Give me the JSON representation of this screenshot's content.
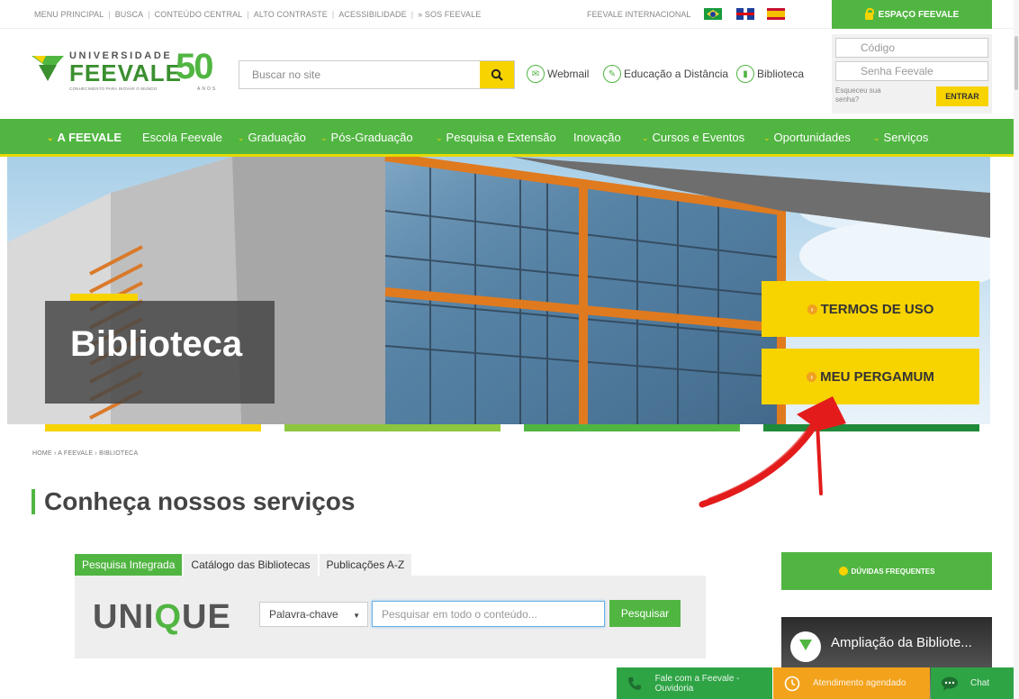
{
  "util": {
    "links": [
      "MENU PRINCIPAL",
      "BUSCA",
      "CONTEÚDO CENTRAL",
      "ALTO CONTRASTE",
      "ACESSIBILIDADE",
      "» SOS FEEVALE"
    ],
    "intl_label": "FEEVALE INTERNACIONAL",
    "espaco_label": "ESPAÇO FEEVALE"
  },
  "logo": {
    "univ": "UNIVERSIDADE",
    "name": "FEEVALE",
    "tagline": "CONHECIMENTO PARA INOVAR O MUNDO",
    "fifty": "50",
    "anos": "ANOS"
  },
  "search": {
    "placeholder": "Buscar no site"
  },
  "header_links": {
    "webmail": "Webmail",
    "ead": "Educação a Distância",
    "biblioteca": "Biblioteca"
  },
  "login": {
    "code_placeholder": "Código",
    "pass_placeholder": "Senha Feevale",
    "forgot": "Esqueceu sua senha?",
    "enter": "ENTRAR"
  },
  "nav": {
    "items": [
      {
        "label": "A FEEVALE"
      },
      {
        "label": "Escola Feevale"
      },
      {
        "label": "Graduação"
      },
      {
        "label": "Pós-Graduação"
      },
      {
        "label": "Pesquisa e Extensão"
      },
      {
        "label": "Inovação"
      },
      {
        "label": "Cursos e Eventos"
      },
      {
        "label": "Oportunidades"
      },
      {
        "label": "Serviços"
      }
    ]
  },
  "hero": {
    "title": "Biblioteca",
    "btn_termos": "TERMOS DE USO",
    "btn_pergamum": "MEU PERGAMUM"
  },
  "breadcrumb": "HOME › A FEEVALE › BIBLIOTECA",
  "section_title": "Conheça nossos serviços",
  "tabs": {
    "t1": "Pesquisa Integrada",
    "t2": "Catálogo das Bibliotecas",
    "t3": "Publicações A-Z"
  },
  "unique": {
    "logo_pre": "UNI",
    "logo_q": "Q",
    "logo_post": "UE",
    "select_value": "Palavra-chave",
    "input_placeholder": "Pesquisar em todo o conteúdo...",
    "search_btn": "Pesquisar"
  },
  "sidebar": {
    "duvidas": "DÚVIDAS FREQUENTES",
    "video_title": "Ampliação da Bibliote..."
  },
  "floating": {
    "fale": "Fale com a Feevale - Ouvidoria",
    "atendimento": "Atendimento agendado",
    "chat": "Chat"
  },
  "colors": {
    "brand_green": "#51b542",
    "brand_yellow": "#f7d300",
    "annotation_red": "#e31b1b"
  }
}
